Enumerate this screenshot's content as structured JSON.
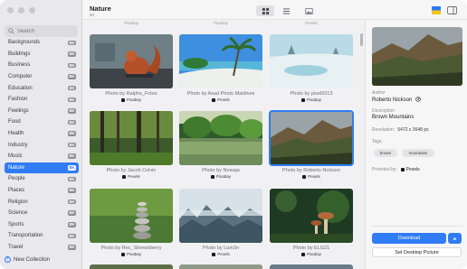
{
  "toolbar": {
    "title": "Nature",
    "subtitle": "90"
  },
  "search": {
    "placeholder": "Search"
  },
  "sidebar": {
    "items": [
      {
        "label": "Backgrounds",
        "badge": "BK"
      },
      {
        "label": "Buildings",
        "badge": "BK"
      },
      {
        "label": "Business",
        "badge": "BK"
      },
      {
        "label": "Computer",
        "badge": "BK"
      },
      {
        "label": "Education",
        "badge": "BK"
      },
      {
        "label": "Fashion",
        "badge": "BK"
      },
      {
        "label": "Feelings",
        "badge": "BK"
      },
      {
        "label": "Food",
        "badge": "BK"
      },
      {
        "label": "Health",
        "badge": "BK"
      },
      {
        "label": "Industry",
        "badge": "BK"
      },
      {
        "label": "Music",
        "badge": "BK"
      },
      {
        "label": "Nature",
        "badge": "BK"
      },
      {
        "label": "People",
        "badge": "BK"
      },
      {
        "label": "Places",
        "badge": "BK"
      },
      {
        "label": "Religion",
        "badge": "BK"
      },
      {
        "label": "Science",
        "badge": "BK"
      },
      {
        "label": "Sports",
        "badge": "BK"
      },
      {
        "label": "Transportation",
        "badge": "BK"
      },
      {
        "label": "Travel",
        "badge": "BK"
      }
    ],
    "selected": "Nature",
    "new_collection": "New Collection"
  },
  "grid": {
    "top_captions": [
      "Pixabay",
      "Pixabay",
      "Pexels"
    ],
    "tiles": [
      {
        "caption": "Photo by Ralphs_Fotos",
        "source": "Pixabay",
        "icon": "squirrel-photo"
      },
      {
        "caption": "Photo by Asad Photo Maldives",
        "source": "Pexels",
        "icon": "beach-photo"
      },
      {
        "caption": "Photo by pixel2013",
        "source": "Pixabay",
        "icon": "winter-lake-photo"
      },
      {
        "caption": "Photo by Jacob Colvin",
        "source": "Pexels",
        "icon": "forest-photo"
      },
      {
        "caption": "Photo by Nowaja",
        "source": "Pixabay",
        "icon": "lake-trees-photo"
      },
      {
        "caption": "Photo by Roberto Nickson",
        "source": "Pexels",
        "icon": "mountains-photo"
      },
      {
        "caption": "Photo by Rec_Shrewsberry",
        "source": "Pixabay",
        "icon": "stones-photo"
      },
      {
        "caption": "Photo by Lum3n",
        "source": "Pexels",
        "icon": "misty-forest-photo"
      },
      {
        "caption": "Photo by ELG21",
        "source": "Pixabay",
        "icon": "mushrooms-photo"
      }
    ]
  },
  "inspector": {
    "author_label": "Author",
    "author": "Roberto Nickson",
    "description_label": "Description",
    "description": "Brown Mountains",
    "resolution_label": "Resolution:",
    "resolution": "5472 x 3648 px",
    "tags_label": "Tags",
    "tags": [
      "brown",
      "mountains"
    ],
    "provided_label": "Provided by:",
    "provider": "Pexels",
    "download_label": "Download",
    "desktop_label": "Set Desktop Picture"
  },
  "colors": {
    "accent": "#2f7cf6",
    "sidebar_bg": "#e9e8ec",
    "grid_bg": "#f1f1f3"
  }
}
